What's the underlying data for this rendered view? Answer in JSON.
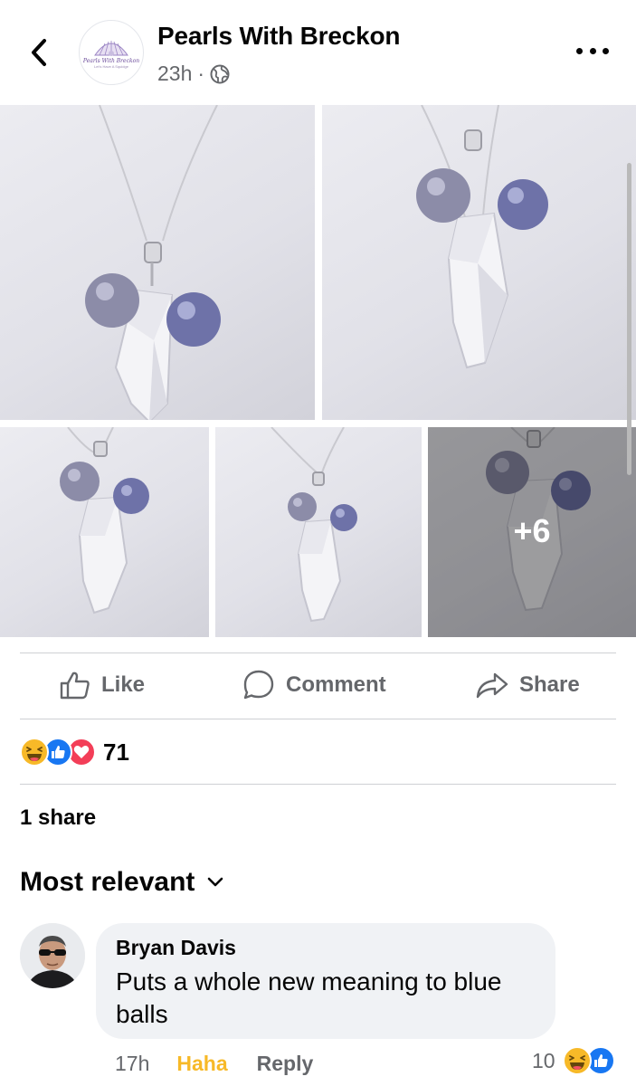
{
  "header": {
    "back_icon": "chevron-left-icon",
    "page_name": "Pearls With Breckon",
    "logo_text": "Pearls With Breckon",
    "logo_subtext": "Let's Have A Squidge",
    "time": "23h",
    "separator": "·",
    "privacy_icon": "globe-icon",
    "more_icon": "more-horizontal-icon"
  },
  "photos": {
    "more_count": "+6",
    "subject": "silver necklace with clear crystal pendant and two purple-grey pearls"
  },
  "actions": {
    "like_label": "Like",
    "comment_label": "Comment",
    "share_label": "Share"
  },
  "reactions": {
    "types": [
      "haha",
      "like",
      "love"
    ],
    "count": "71"
  },
  "shares": {
    "label": "1 share"
  },
  "comments": {
    "sort_label": "Most relevant",
    "items": [
      {
        "author": "Bryan Davis",
        "text": "Puts a whole new meaning to blue balls",
        "time": "17h",
        "my_reaction": "Haha",
        "reply_label": "Reply",
        "reaction_count": "10",
        "reaction_types": [
          "haha",
          "like"
        ]
      }
    ]
  },
  "colors": {
    "brand_blue": "#1877f2",
    "haha_yellow": "#f7b928",
    "love_red": "#f33e58",
    "secondary_text": "#65676b",
    "bubble_bg": "#f0f2f5"
  }
}
